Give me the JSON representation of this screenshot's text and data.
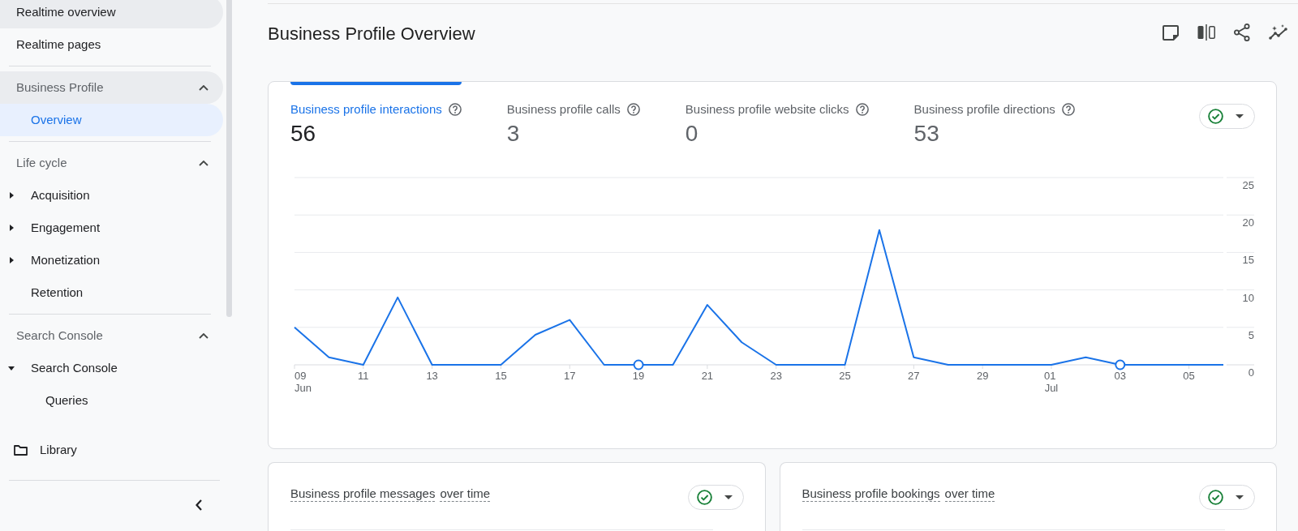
{
  "sidebar": {
    "top_items": [
      {
        "label": "Realtime overview",
        "highlighted": true,
        "selected": false
      },
      {
        "label": "Realtime pages",
        "highlighted": false,
        "selected": false
      }
    ],
    "sections": [
      {
        "title": "Business Profile",
        "expanded": true,
        "highlighted": true,
        "items": [
          {
            "label": "Overview",
            "kind": "page",
            "selected": true
          }
        ]
      },
      {
        "title": "Life cycle",
        "expanded": true,
        "highlighted": false,
        "items": [
          {
            "label": "Acquisition",
            "kind": "group",
            "expanded": false,
            "selected": false
          },
          {
            "label": "Engagement",
            "kind": "group",
            "expanded": false,
            "selected": false
          },
          {
            "label": "Monetization",
            "kind": "group",
            "expanded": false,
            "selected": false
          },
          {
            "label": "Retention",
            "kind": "page",
            "selected": false
          }
        ]
      },
      {
        "title": "Search Console",
        "expanded": true,
        "highlighted": false,
        "items": [
          {
            "label": "Search Console",
            "kind": "group",
            "expanded": true,
            "selected": false,
            "children": [
              {
                "label": "Queries",
                "selected": false
              }
            ]
          }
        ]
      }
    ],
    "library": {
      "label": "Library"
    }
  },
  "page": {
    "title": "Business Profile Overview"
  },
  "overview_card": {
    "metrics": [
      {
        "label": "Business profile interactions",
        "value": "56",
        "selected": true
      },
      {
        "label": "Business profile calls",
        "value": "3",
        "selected": false
      },
      {
        "label": "Business profile website clicks",
        "value": "0",
        "selected": false
      },
      {
        "label": "Business profile directions",
        "value": "53",
        "selected": false
      }
    ],
    "chart_data": {
      "type": "line",
      "categories": [
        "09 Jun",
        null,
        "11",
        null,
        "13",
        null,
        "15",
        null,
        "17",
        null,
        "19",
        null,
        "21",
        null,
        "23",
        null,
        "25",
        null,
        "27",
        null,
        "29",
        null,
        "01 Jul",
        null,
        "03",
        null,
        "05",
        null
      ],
      "series": [
        {
          "color": "#1a73e8",
          "values": [
            5,
            1,
            0,
            9,
            0,
            0,
            0,
            4,
            6,
            0,
            0,
            0,
            8,
            3,
            0,
            0,
            0,
            18,
            1,
            0,
            0,
            0,
            0,
            1,
            0,
            0,
            0,
            0
          ]
        }
      ],
      "ylim": [
        0,
        25
      ],
      "yticks": [
        0,
        5,
        10,
        15,
        20,
        25
      ],
      "grid": true,
      "annotations": [
        {
          "x": "19"
        },
        {
          "x": "03"
        }
      ]
    }
  },
  "cards": [
    {
      "title_parts": [
        "Business profile messages",
        "over time"
      ]
    },
    {
      "title_parts": [
        "Business profile bookings",
        "over time"
      ]
    }
  ]
}
